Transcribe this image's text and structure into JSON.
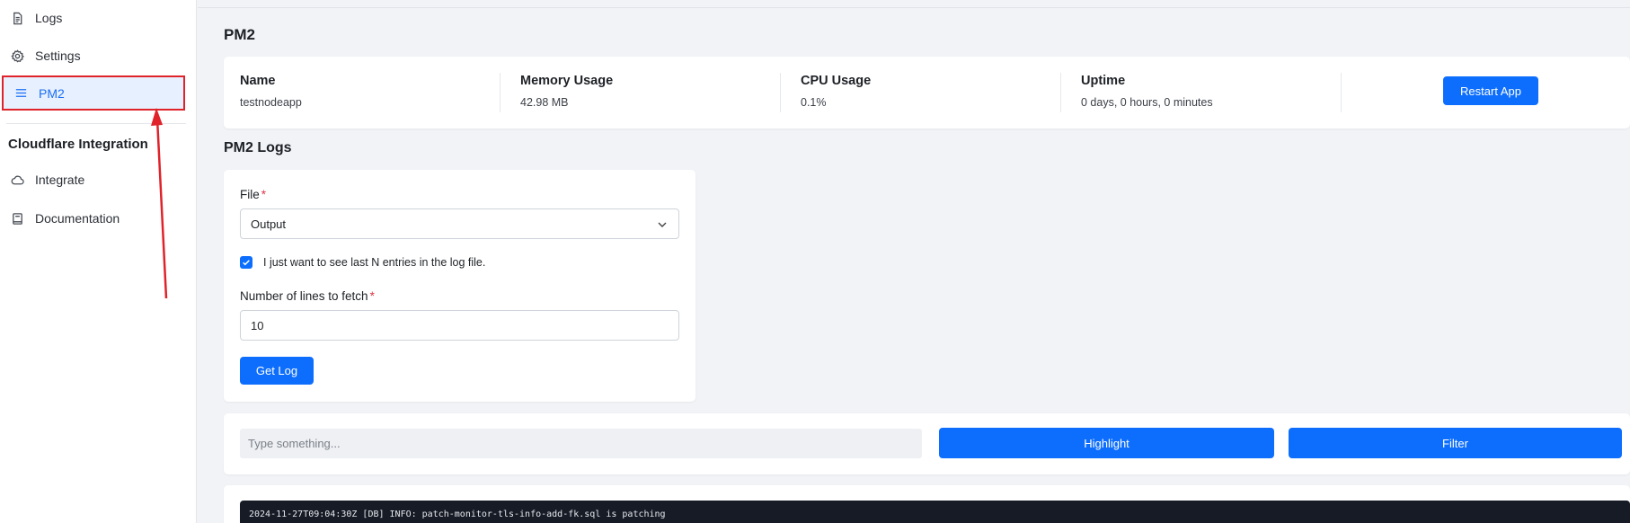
{
  "sidebar": {
    "items": [
      {
        "label": "Logs",
        "icon": "file-text-icon"
      },
      {
        "label": "Settings",
        "icon": "gear-icon"
      },
      {
        "label": "PM2",
        "icon": "menu-icon",
        "active": true
      }
    ],
    "section_title": "Cloudflare Integration",
    "section_items": [
      {
        "label": "Integrate",
        "icon": "cloud-icon"
      },
      {
        "label": "Documentation",
        "icon": "book-icon"
      }
    ]
  },
  "page": {
    "title": "PM2",
    "stats": {
      "name_label": "Name",
      "name_value": "testnodeapp",
      "memory_label": "Memory Usage",
      "memory_value": "42.98 MB",
      "cpu_label": "CPU Usage",
      "cpu_value": "0.1%",
      "uptime_label": "Uptime",
      "uptime_value": "0 days, 0 hours, 0 minutes",
      "restart_label": "Restart App"
    },
    "logs_title": "PM2 Logs",
    "form": {
      "file_label": "File",
      "file_value": "Output",
      "checkbox_label": "I just want to see last N entries in the log file.",
      "checkbox_checked": true,
      "lines_label": "Number of lines to fetch",
      "lines_value": "10",
      "get_log_label": "Get Log"
    },
    "toolbar": {
      "search_placeholder": "Type something...",
      "highlight_label": "Highlight",
      "filter_label": "Filter"
    },
    "log_lines": [
      "2024-11-27T09:04:30Z [DB] INFO: patch-monitor-tls-info-add-fk.sql is patching"
    ]
  },
  "colors": {
    "accent": "#0d6efd",
    "active_bg": "#e7f0fe",
    "annotation": "#e0222a",
    "log_bg": "#161b26"
  }
}
